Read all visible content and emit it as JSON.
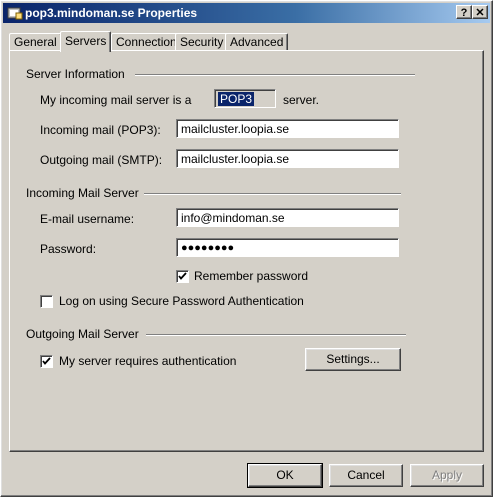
{
  "window": {
    "title": "pop3.mindoman.se Properties",
    "help_glyph": "?",
    "close_glyph": "✕"
  },
  "tabs": [
    {
      "label": "General"
    },
    {
      "label": "Servers",
      "active": true
    },
    {
      "label": "Connection"
    },
    {
      "label": "Security"
    },
    {
      "label": "Advanced"
    }
  ],
  "server_information": {
    "heading": "Server Information",
    "incoming_type_prefix": "My incoming mail server is a",
    "incoming_type_value": "POP3",
    "incoming_type_suffix": "server.",
    "incoming_label": "Incoming mail (POP3):",
    "incoming_value": "mailcluster.loopia.se",
    "outgoing_label": "Outgoing mail (SMTP):",
    "outgoing_value": "mailcluster.loopia.se"
  },
  "incoming_mail_server": {
    "heading": "Incoming Mail Server",
    "username_label": "E-mail username:",
    "username_value": "info@mindoman.se",
    "password_label": "Password:",
    "password_value": "●●●●●●●●",
    "remember_label": "Remember password",
    "remember_checked": true,
    "spa_label": "Log on using Secure Password Authentication",
    "spa_checked": false
  },
  "outgoing_mail_server": {
    "heading": "Outgoing Mail Server",
    "auth_label": "My server requires authentication",
    "auth_checked": true,
    "settings_label": "Settings..."
  },
  "footer": {
    "ok_label": "OK",
    "cancel_label": "Cancel",
    "apply_label": "Apply"
  }
}
